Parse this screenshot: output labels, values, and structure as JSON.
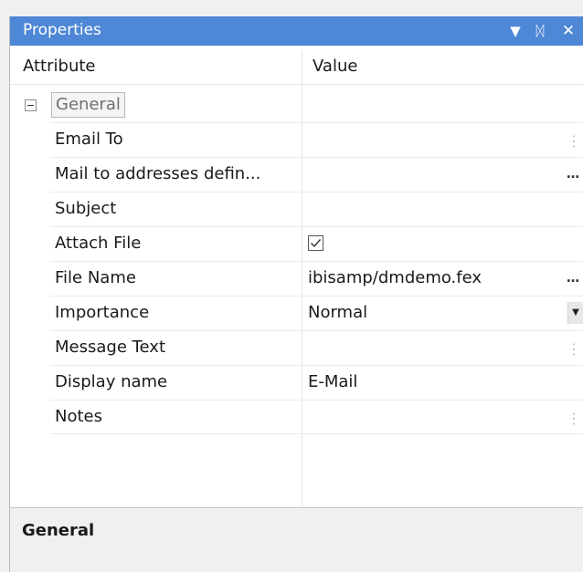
{
  "panel": {
    "title": "Properties",
    "title_bar_color": "#4d87d6",
    "controls": [
      {
        "name": "dropdown-arrow-icon",
        "glyph": "▼"
      },
      {
        "name": "pin-icon",
        "glyph": "ᛞ"
      },
      {
        "name": "close-icon",
        "glyph": "✕"
      }
    ]
  },
  "grid": {
    "header": {
      "attribute": "Attribute",
      "value": "Value"
    },
    "category": {
      "label": "General",
      "expander_icon": "collapse-minus-icon"
    },
    "rows": [
      {
        "name": "Email To",
        "value": "",
        "editor": "vertical-ellipsis-icon"
      },
      {
        "name": "Mail to addresses defin...",
        "value": "",
        "editor": "ellipsis-icon"
      },
      {
        "name": "Subject",
        "value": "",
        "editor": ""
      },
      {
        "name": "Attach File",
        "value": "",
        "editor": "",
        "checked": true
      },
      {
        "name": "File Name",
        "value": "ibisamp/dmdemo.fex",
        "editor": "ellipsis-icon"
      },
      {
        "name": "Importance",
        "value": "Normal",
        "editor": "dropdown-icon"
      },
      {
        "name": "Message Text",
        "value": "",
        "editor": "vertical-ellipsis-icon"
      },
      {
        "name": "Display name",
        "value": "E-Mail",
        "editor": ""
      },
      {
        "name": "Notes",
        "value": "",
        "editor": "vertical-ellipsis-icon"
      }
    ]
  },
  "description": {
    "title": "General"
  }
}
